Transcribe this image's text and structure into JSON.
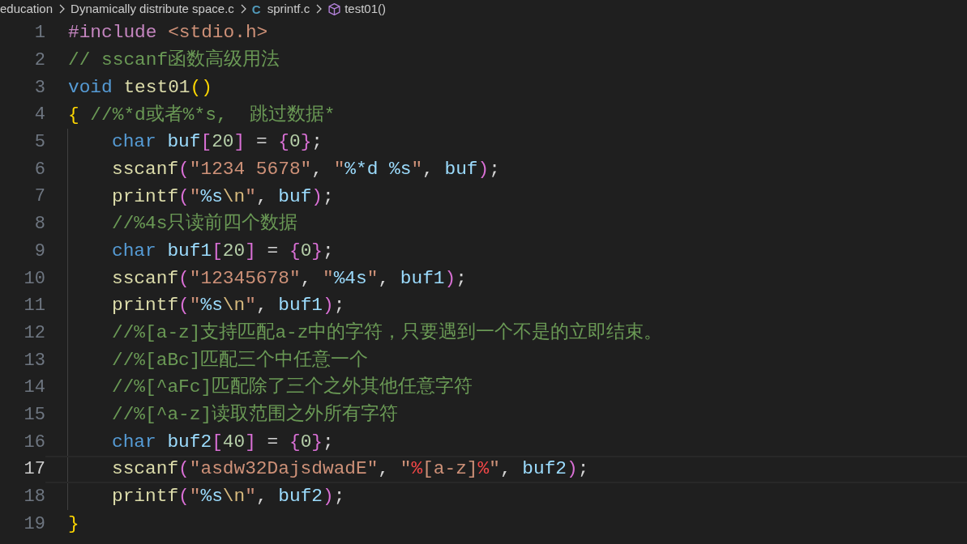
{
  "breadcrumb": [
    {
      "label": "education",
      "kind": "folder"
    },
    {
      "label": "Dynamically distribute space.c",
      "kind": "folder"
    },
    {
      "label": "sprintf.c",
      "kind": "c-file",
      "icon": "C"
    },
    {
      "label": "test01()",
      "kind": "function"
    }
  ],
  "editor": {
    "lines": [
      {
        "number": "1",
        "current": false,
        "indented": false,
        "tokens": [
          {
            "text": "#include ",
            "kind": "pp"
          },
          {
            "text": "<stdio.h>",
            "kind": "str"
          }
        ]
      },
      {
        "number": "2",
        "current": false,
        "indented": false,
        "tokens": [
          {
            "text": "// sscanf函数高级用法",
            "kind": "cmt"
          }
        ]
      },
      {
        "number": "3",
        "current": false,
        "indented": false,
        "tokens": [
          {
            "text": "void ",
            "kind": "kw"
          },
          {
            "text": "test01",
            "kind": "fn"
          },
          {
            "text": "()",
            "kind": "b1"
          }
        ]
      },
      {
        "number": "4",
        "current": false,
        "indented": false,
        "tokens": [
          {
            "text": "{",
            "kind": "b1"
          },
          {
            "text": " //%*d或者%*s,  跳过数据*",
            "kind": "cmt"
          }
        ]
      },
      {
        "number": "5",
        "current": false,
        "indented": true,
        "tokens": [
          {
            "text": "char ",
            "kind": "kw"
          },
          {
            "text": "buf",
            "kind": "var"
          },
          {
            "text": "[",
            "kind": "b2"
          },
          {
            "text": "20",
            "kind": "num"
          },
          {
            "text": "]",
            "kind": "b2"
          },
          {
            "text": " = ",
            "kind": "op"
          },
          {
            "text": "{",
            "kind": "b2"
          },
          {
            "text": "0",
            "kind": "num"
          },
          {
            "text": "}",
            "kind": "b2"
          },
          {
            "text": ";",
            "kind": "op"
          }
        ]
      },
      {
        "number": "6",
        "current": false,
        "indented": true,
        "tokens": [
          {
            "text": "sscanf",
            "kind": "fn"
          },
          {
            "text": "(",
            "kind": "b2"
          },
          {
            "text": "\"1234 5678\"",
            "kind": "str"
          },
          {
            "text": ", ",
            "kind": "op"
          },
          {
            "text": "\"",
            "kind": "str"
          },
          {
            "text": "%*d %s",
            "kind": "fmt"
          },
          {
            "text": "\"",
            "kind": "str"
          },
          {
            "text": ", ",
            "kind": "op"
          },
          {
            "text": "buf",
            "kind": "var"
          },
          {
            "text": ")",
            "kind": "b2"
          },
          {
            "text": ";",
            "kind": "op"
          }
        ]
      },
      {
        "number": "7",
        "current": false,
        "indented": true,
        "tokens": [
          {
            "text": "printf",
            "kind": "fn"
          },
          {
            "text": "(",
            "kind": "b2"
          },
          {
            "text": "\"",
            "kind": "str"
          },
          {
            "text": "%s",
            "kind": "fmt"
          },
          {
            "text": "\\n",
            "kind": "esc"
          },
          {
            "text": "\"",
            "kind": "str"
          },
          {
            "text": ", ",
            "kind": "op"
          },
          {
            "text": "buf",
            "kind": "var"
          },
          {
            "text": ")",
            "kind": "b2"
          },
          {
            "text": ";",
            "kind": "op"
          }
        ]
      },
      {
        "number": "8",
        "current": false,
        "indented": true,
        "tokens": [
          {
            "text": "//%4s只读前四个数据",
            "kind": "cmt"
          }
        ]
      },
      {
        "number": "9",
        "current": false,
        "indented": true,
        "tokens": [
          {
            "text": "char ",
            "kind": "kw"
          },
          {
            "text": "buf1",
            "kind": "var"
          },
          {
            "text": "[",
            "kind": "b2"
          },
          {
            "text": "20",
            "kind": "num"
          },
          {
            "text": "]",
            "kind": "b2"
          },
          {
            "text": " = ",
            "kind": "op"
          },
          {
            "text": "{",
            "kind": "b2"
          },
          {
            "text": "0",
            "kind": "num"
          },
          {
            "text": "}",
            "kind": "b2"
          },
          {
            "text": ";",
            "kind": "op"
          }
        ]
      },
      {
        "number": "10",
        "current": false,
        "indented": true,
        "tokens": [
          {
            "text": "sscanf",
            "kind": "fn"
          },
          {
            "text": "(",
            "kind": "b2"
          },
          {
            "text": "\"12345678\"",
            "kind": "str"
          },
          {
            "text": ", ",
            "kind": "op"
          },
          {
            "text": "\"",
            "kind": "str"
          },
          {
            "text": "%4s",
            "kind": "fmt"
          },
          {
            "text": "\"",
            "kind": "str"
          },
          {
            "text": ", ",
            "kind": "op"
          },
          {
            "text": "buf1",
            "kind": "var"
          },
          {
            "text": ")",
            "kind": "b2"
          },
          {
            "text": ";",
            "kind": "op"
          }
        ]
      },
      {
        "number": "11",
        "current": false,
        "indented": true,
        "tokens": [
          {
            "text": "printf",
            "kind": "fn"
          },
          {
            "text": "(",
            "kind": "b2"
          },
          {
            "text": "\"",
            "kind": "str"
          },
          {
            "text": "%s",
            "kind": "fmt"
          },
          {
            "text": "\\n",
            "kind": "esc"
          },
          {
            "text": "\"",
            "kind": "str"
          },
          {
            "text": ", ",
            "kind": "op"
          },
          {
            "text": "buf1",
            "kind": "var"
          },
          {
            "text": ")",
            "kind": "b2"
          },
          {
            "text": ";",
            "kind": "op"
          }
        ]
      },
      {
        "number": "12",
        "current": false,
        "indented": true,
        "tokens": [
          {
            "text": "//%[a-z]支持匹配a-z中的字符，只要遇到一个不是的立即结束。",
            "kind": "cmt"
          }
        ]
      },
      {
        "number": "13",
        "current": false,
        "indented": true,
        "tokens": [
          {
            "text": "//%[aBc]匹配三个中任意一个",
            "kind": "cmt"
          }
        ]
      },
      {
        "number": "14",
        "current": false,
        "indented": true,
        "tokens": [
          {
            "text": "//%[^aFc]匹配除了三个之外其他任意字符",
            "kind": "cmt"
          }
        ]
      },
      {
        "number": "15",
        "current": false,
        "indented": true,
        "tokens": [
          {
            "text": "//%[^a-z]读取范围之外所有字符",
            "kind": "cmt"
          }
        ]
      },
      {
        "number": "16",
        "current": false,
        "indented": true,
        "tokens": [
          {
            "text": "char ",
            "kind": "kw"
          },
          {
            "text": "buf2",
            "kind": "var"
          },
          {
            "text": "[",
            "kind": "b2"
          },
          {
            "text": "40",
            "kind": "num"
          },
          {
            "text": "]",
            "kind": "b2"
          },
          {
            "text": " = ",
            "kind": "op"
          },
          {
            "text": "{",
            "kind": "b2"
          },
          {
            "text": "0",
            "kind": "num"
          },
          {
            "text": "}",
            "kind": "b2"
          },
          {
            "text": ";",
            "kind": "op"
          }
        ]
      },
      {
        "number": "17",
        "current": true,
        "indented": true,
        "tokens": [
          {
            "text": "sscanf",
            "kind": "fn"
          },
          {
            "text": "(",
            "kind": "b2"
          },
          {
            "text": "\"asdw32DajsdwadE\"",
            "kind": "str"
          },
          {
            "text": ", ",
            "kind": "op"
          },
          {
            "text": "\"",
            "kind": "str"
          },
          {
            "text": "%",
            "kind": "bad"
          },
          {
            "text": "[a-z]",
            "kind": "str"
          },
          {
            "text": "%",
            "kind": "bad"
          },
          {
            "text": "\"",
            "kind": "str"
          },
          {
            "text": ", ",
            "kind": "op"
          },
          {
            "text": "buf2",
            "kind": "var"
          },
          {
            "text": ")",
            "kind": "b2"
          },
          {
            "text": ";",
            "kind": "op"
          }
        ]
      },
      {
        "number": "18",
        "current": false,
        "indented": true,
        "tokens": [
          {
            "text": "printf",
            "kind": "fn"
          },
          {
            "text": "(",
            "kind": "b2"
          },
          {
            "text": "\"",
            "kind": "str"
          },
          {
            "text": "%s",
            "kind": "fmt"
          },
          {
            "text": "\\n",
            "kind": "esc"
          },
          {
            "text": "\"",
            "kind": "str"
          },
          {
            "text": ", ",
            "kind": "op"
          },
          {
            "text": "buf2",
            "kind": "var"
          },
          {
            "text": ")",
            "kind": "b2"
          },
          {
            "text": ";",
            "kind": "op"
          }
        ]
      },
      {
        "number": "19",
        "current": false,
        "indented": false,
        "tokens": [
          {
            "text": "}",
            "kind": "b1"
          }
        ]
      }
    ]
  }
}
